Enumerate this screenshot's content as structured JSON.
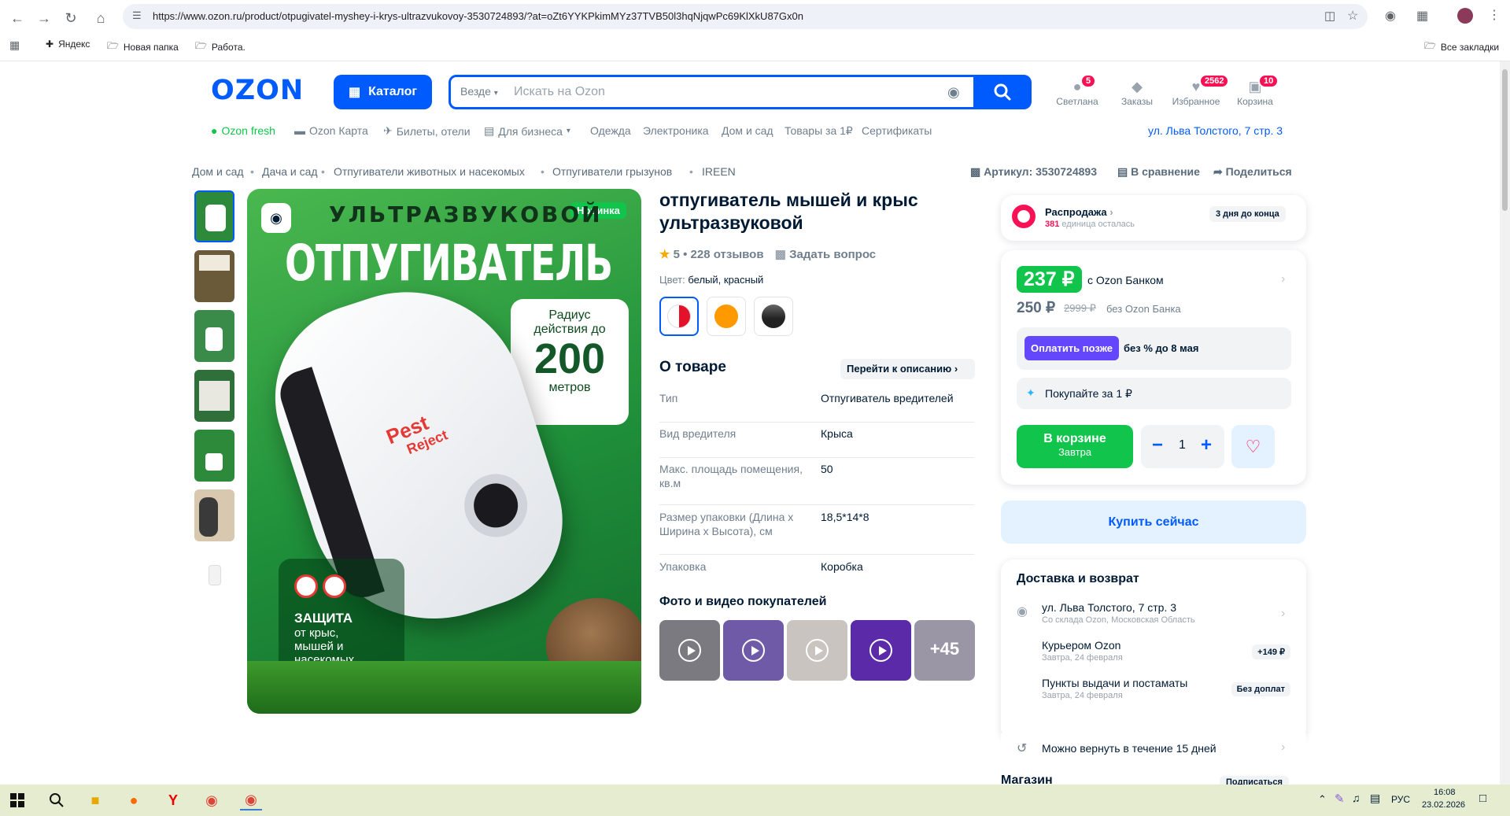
{
  "browser": {
    "url": "https://www.ozon.ru/product/otpugivatel-myshey-i-krys-ultrazvukovoy-3530724893/?at=oZt6YYKPkimMYz37TVB50l3hqNjqwPc69KlXkU87Gx0n",
    "bookmarks": [
      "Яндекс",
      "Новая папка",
      "Работа."
    ],
    "all_bookmarks": "Все закладки"
  },
  "header": {
    "logo": "OZON",
    "catalog_label": "Каталог",
    "search_scope": "Везде",
    "search_placeholder": "Искать на Ozon",
    "icons": [
      {
        "label": "Светлана",
        "badge": "5",
        "icon": "user-icon"
      },
      {
        "label": "Заказы",
        "badge": "",
        "icon": "box-icon"
      },
      {
        "label": "Избранное",
        "badge": "2562",
        "icon": "heart-icon"
      },
      {
        "label": "Корзина",
        "badge": "10",
        "icon": "cart-icon"
      }
    ]
  },
  "subnav": {
    "items": [
      "Ozon fresh",
      "Ozon Карта",
      "Билеты, отели",
      "Для бизнеса",
      "Одежда",
      "Электроника",
      "Дом и сад",
      "Товары за 1₽",
      "Сертификаты"
    ],
    "address": "ул. Льва Толстого, 7 стр. 3"
  },
  "breadcrumbs": [
    "Дом и сад",
    "Дача и сад",
    "Отпугиватели животных и насекомых",
    "Отпугиватели грызунов",
    "IREEN"
  ],
  "actions": {
    "article": "Артикул: 3530724893",
    "compare": "В сравнение",
    "share": "Поделиться"
  },
  "gallery": {
    "badge": "Новинка",
    "headline_1": "УЛЬТРАЗВУКОВОЙ",
    "headline_2": "ОТПУГИВАТЕЛЬ",
    "radius_1": "Радиус",
    "radius_2": "действия до",
    "radius_value": "200",
    "radius_unit": "метров",
    "brand_1": "Pest",
    "brand_2": "Reject",
    "protect_title": "ЗАЩИТА",
    "protect_lines": [
      "от крыс,",
      "мышей и",
      "насекомых"
    ]
  },
  "product": {
    "title": "отпугиватель мышей и крыс ультразвуковой",
    "rating": "5 • 228 отзывов",
    "ask": "Задать вопрос",
    "color_label": "Цвет:",
    "color_value": "белый, красный",
    "about": "О товаре",
    "to_description": "Перейти к описанию",
    "props": [
      {
        "k": "Тип",
        "v": "Отпугиватель вредителей"
      },
      {
        "k": "Вид вредителя",
        "v": "Крыса"
      },
      {
        "k": "Макс. площадь помещения, кв.м",
        "v": "50"
      },
      {
        "k": "Размер упаковки (Длина x Ширина x Высота), см",
        "v": "18,5*14*8"
      },
      {
        "k": "Упаковка",
        "v": "Коробка"
      }
    ],
    "ugc_title": "Фото и видео покупателей",
    "ugc_more": "+45"
  },
  "sale": {
    "title": "Распродажа",
    "count": "381",
    "units": "единица осталась",
    "days": "3 дня до конца"
  },
  "price": {
    "card_price": "237 ₽",
    "card_label": "с Ozon Банком",
    "regular": "250 ₽",
    "old": "2999 ₽",
    "no_bank": "без Ozon Банка",
    "pay_later": "Оплатить позже",
    "pay_later_note": "без % до 8 мая",
    "buy_for_1": "Покупайте за 1 ₽",
    "in_cart": "В корзине",
    "in_cart_sub": "Завтра",
    "qty": "1",
    "buy_now": "Купить сейчас"
  },
  "delivery": {
    "title": "Доставка и возврат",
    "address": "ул. Льва Толстого, 7 стр. 3",
    "address_sub": "Со склада Ozon, Московская Область",
    "courier": "Курьером Ozon",
    "courier_sub": "Завтра, 24 февраля",
    "courier_price": "+149 ₽",
    "pickup": "Пункты выдачи и постаматы",
    "pickup_sub": "Завтра, 24 февраля",
    "pickup_price": "Без доплат",
    "return": "Можно вернуть в течение 15 дней",
    "shop": "Магазин",
    "subscribe": "Подписаться"
  },
  "taskbar": {
    "lang": "РУС",
    "time": "16:08",
    "date": "23.02.2026"
  },
  "colors": {
    "ozon_blue": "#005bff",
    "green": "#10c44c",
    "pink": "#f91155",
    "pay_later": "#6546ff"
  }
}
